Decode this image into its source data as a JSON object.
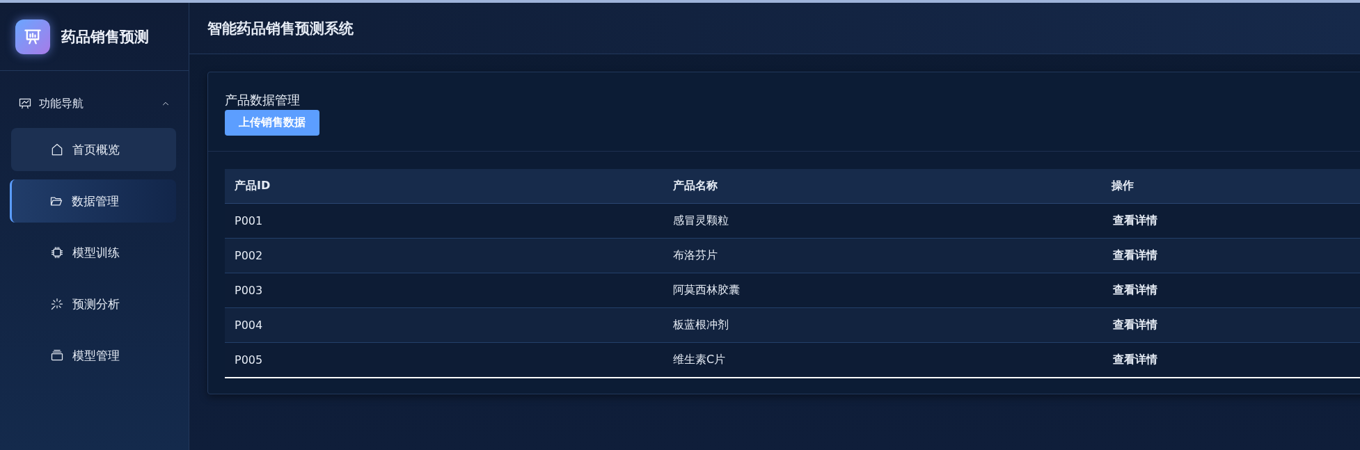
{
  "app": {
    "title": "药品销售预测"
  },
  "nav": {
    "label": "功能导航",
    "expanded": true,
    "items": [
      {
        "label": "首页概览",
        "kind": "home",
        "selected": false,
        "hovered": true
      },
      {
        "label": "数据管理",
        "kind": "folder",
        "selected": true,
        "hovered": false
      },
      {
        "label": "模型训练",
        "kind": "chip",
        "selected": false,
        "hovered": false
      },
      {
        "label": "预测分析",
        "kind": "spark",
        "selected": false,
        "hovered": false
      },
      {
        "label": "模型管理",
        "kind": "stack",
        "selected": false,
        "hovered": false
      }
    ]
  },
  "header": {
    "title": "智能药品销售预测系统"
  },
  "panel": {
    "title": "产品数据管理",
    "upload_button": "上传销售数据",
    "table": {
      "columns": [
        "产品ID",
        "产品名称",
        "操作"
      ],
      "rows": [
        {
          "id": "P001",
          "name": "感冒灵颗粒",
          "action": "查看详情"
        },
        {
          "id": "P002",
          "name": "布洛芬片",
          "action": "查看详情"
        },
        {
          "id": "P003",
          "name": "阿莫西林胶囊",
          "action": "查看详情"
        },
        {
          "id": "P004",
          "name": "板蓝根冲剂",
          "action": "查看详情"
        },
        {
          "id": "P005",
          "name": "维生素C片",
          "action": "查看详情"
        }
      ]
    }
  }
}
